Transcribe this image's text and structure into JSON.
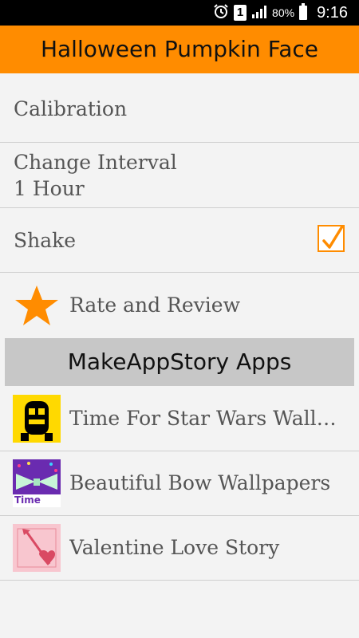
{
  "status_bar": {
    "battery_percent": "80%",
    "time": "9:16",
    "sim_label": "1",
    "icons": [
      "alarm-icon",
      "sim-icon",
      "signal-icon",
      "battery-icon"
    ]
  },
  "app_bar": {
    "title": "Halloween Pumpkin Face",
    "color": "#ff8c00"
  },
  "settings": {
    "calibration_label": "Calibration",
    "interval_label": "Change Interval",
    "interval_value": "1 Hour",
    "shake_label": "Shake",
    "shake_checked": true,
    "rate_label": "Rate and Review"
  },
  "apps_section": {
    "title": "MakeAppStory Apps",
    "items": [
      {
        "label": "Time For Star Wars Wallpapers",
        "icon": "robot-thumbnail"
      },
      {
        "label": "Beautiful Bow Wallpapers",
        "icon": "bow-thumbnail",
        "thumb_text": "Time Bow"
      },
      {
        "label": "Valentine Love Story",
        "icon": "heart-arrow-thumbnail"
      }
    ]
  }
}
